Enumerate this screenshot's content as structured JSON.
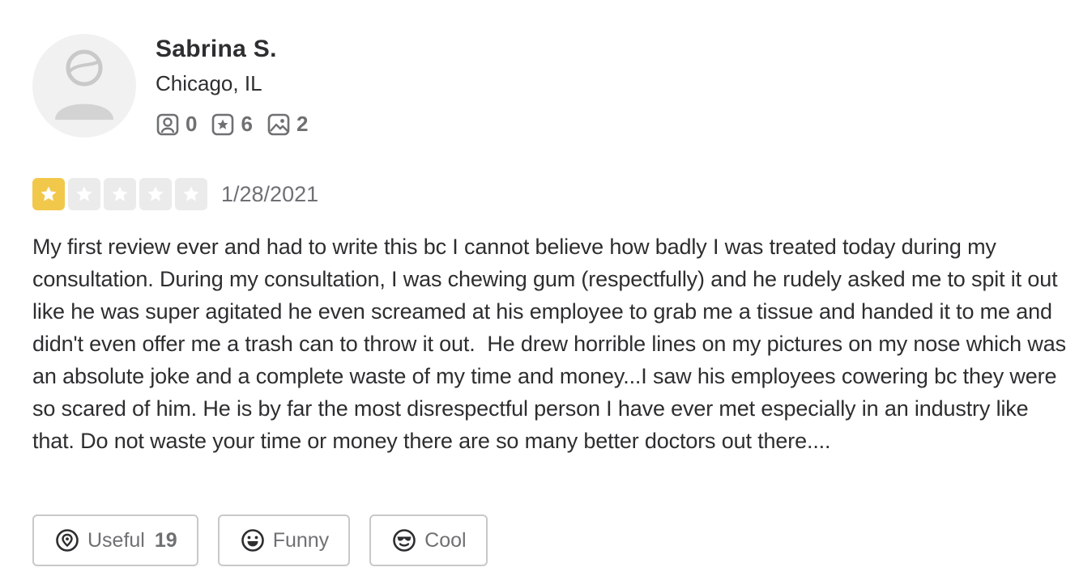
{
  "user": {
    "name": "Sabrina S.",
    "location": "Chicago, IL",
    "stats": {
      "friends": "0",
      "reviews": "6",
      "photos": "2"
    }
  },
  "review": {
    "rating": 1,
    "rating_max": 5,
    "date": "1/28/2021",
    "text": "My first review ever and had to write this bc I cannot believe how badly I was treated today during my consultation. During my consultation, I was chewing gum (respectfully) and he rudely asked me to spit it out like he was super agitated he even screamed at his employee to grab me a tissue and handed it to me and didn't even offer me a trash can to throw it out.  He drew horrible lines on my pictures on my nose which was an absolute joke and a complete waste of my time and money...I saw his employees cowering bc they were so scared of him. He is by far the most disrespectful person I have ever met especially in an industry like that. Do not waste your time or money there are so many better doctors out there...."
  },
  "reactions": {
    "useful_label": "Useful",
    "useful_count": "19",
    "funny_label": "Funny",
    "cool_label": "Cool"
  },
  "colors": {
    "star_filled": "#f2c84b",
    "star_empty": "#ebebeb"
  },
  "icons": {
    "friends": "friends-icon",
    "reviews": "reviews-icon",
    "photos": "photos-icon",
    "useful": "useful-icon",
    "funny": "funny-icon",
    "cool": "cool-icon"
  }
}
